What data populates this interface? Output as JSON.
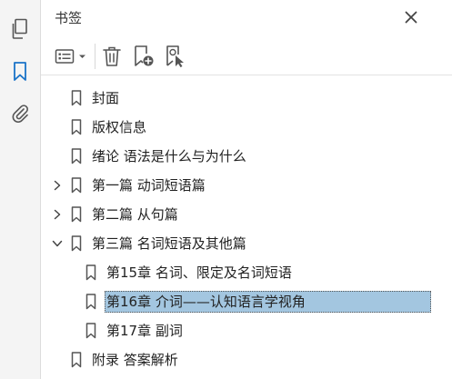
{
  "panel": {
    "title": "书签"
  },
  "rail": {
    "icons": [
      "pages-icon",
      "bookmark-icon",
      "attachment-icon"
    ]
  },
  "toolbar": {
    "buttons": [
      "options-menu-icon",
      "delete-icon",
      "new-bookmark-icon",
      "bookmark-from-selection-icon"
    ]
  },
  "bookmarks": [
    {
      "label": "封面",
      "level": 0,
      "caret": "none"
    },
    {
      "label": "版权信息",
      "level": 0,
      "caret": "none"
    },
    {
      "label": "绪论 语法是什么与为什么",
      "level": 0,
      "caret": "none"
    },
    {
      "label": "第一篇 动词短语篇",
      "level": 0,
      "caret": "collapsed"
    },
    {
      "label": "第二篇 从句篇",
      "level": 0,
      "caret": "collapsed"
    },
    {
      "label": "第三篇 名词短语及其他篇",
      "level": 0,
      "caret": "expanded"
    },
    {
      "label": "第15章 名词、限定及名词短语",
      "level": 1,
      "caret": "none"
    },
    {
      "label": "第16章 介词——认知语言学视角",
      "level": 1,
      "caret": "none",
      "selected": true
    },
    {
      "label": "第17章 副词",
      "level": 1,
      "caret": "none"
    },
    {
      "label": "附录 答案解析",
      "level": 0,
      "caret": "none"
    }
  ],
  "colors": {
    "accent": "#1a73c8",
    "selection": "#a3c6e0",
    "icon": "#555555"
  }
}
